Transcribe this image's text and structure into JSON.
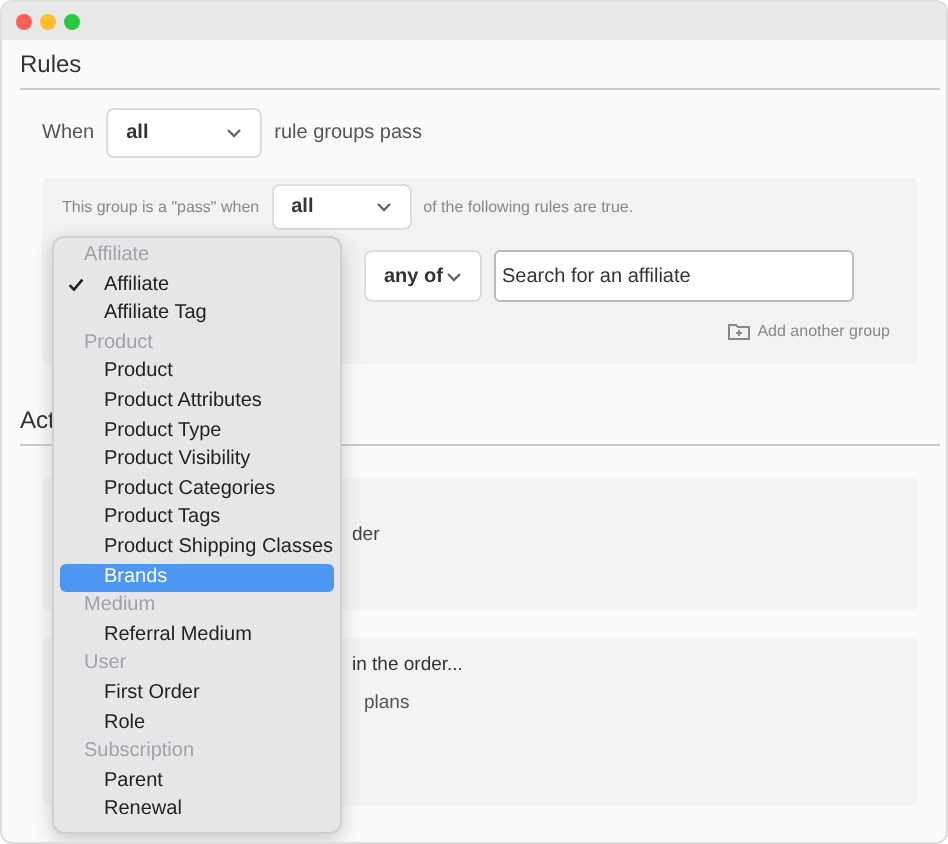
{
  "rules": {
    "heading": "Rules",
    "when_label": "When",
    "when_select": "all",
    "when_suffix": "rule groups pass",
    "group": {
      "intro": "This group is a \"pass\" when",
      "match_select": "all",
      "suffix": "of the following rules are true.",
      "operator_select": "any of",
      "search": {
        "placeholder": "Search for an affiliate"
      },
      "add_group": "Add another group"
    }
  },
  "actions": {
    "heading": "Act",
    "panel_1_text": "der",
    "panel_2_title": "in the order...",
    "panel_2_text": "plans"
  },
  "menu": {
    "groups": [
      {
        "label": "Affiliate",
        "items": [
          {
            "label": "Affiliate",
            "checked": true,
            "selected": false
          },
          {
            "label": "Affiliate Tag",
            "checked": false,
            "selected": false
          }
        ]
      },
      {
        "label": "Product",
        "items": [
          {
            "label": "Product",
            "checked": false,
            "selected": false
          },
          {
            "label": "Product Attributes",
            "checked": false,
            "selected": false
          },
          {
            "label": "Product Type",
            "checked": false,
            "selected": false
          },
          {
            "label": "Product Visibility",
            "checked": false,
            "selected": false
          },
          {
            "label": "Product Categories",
            "checked": false,
            "selected": false
          },
          {
            "label": "Product Tags",
            "checked": false,
            "selected": false
          },
          {
            "label": "Product Shipping Classes",
            "checked": false,
            "selected": false
          },
          {
            "label": "Brands",
            "checked": false,
            "selected": true
          }
        ]
      },
      {
        "label": "Medium",
        "items": [
          {
            "label": "Referral Medium",
            "checked": false,
            "selected": false
          }
        ]
      },
      {
        "label": "User",
        "items": [
          {
            "label": "First Order",
            "checked": false,
            "selected": false
          },
          {
            "label": "Role",
            "checked": false,
            "selected": false
          }
        ]
      },
      {
        "label": "Subscription",
        "items": [
          {
            "label": "Parent",
            "checked": false,
            "selected": false
          },
          {
            "label": "Renewal",
            "checked": false,
            "selected": false
          }
        ]
      }
    ]
  }
}
